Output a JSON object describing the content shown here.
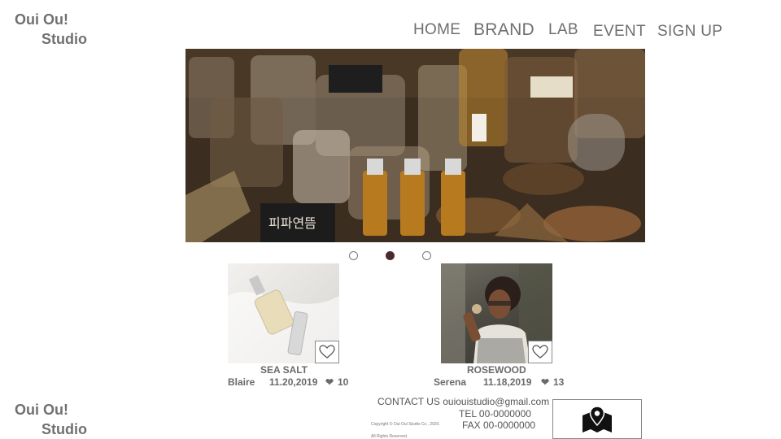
{
  "brand": {
    "line1": "Oui Ou!",
    "line2": "Studio"
  },
  "nav": [
    {
      "label": "HOME"
    },
    {
      "label": "BRAND"
    },
    {
      "label": "LAB"
    },
    {
      "label": "EVENT"
    },
    {
      "label": "SIGN UP"
    }
  ],
  "hero": {
    "image_icon": "perfume-bottles-photo",
    "label_text": "피파연뜸"
  },
  "carousel": {
    "count": 3,
    "active_index": 1
  },
  "cards": [
    {
      "title": "SEA SALT",
      "author": "Blaire",
      "date": "11.20,2019",
      "likes": "10",
      "image_icon": "perfume-bottle-photo"
    },
    {
      "title": "ROSEWOOD",
      "author": "Serena",
      "date": "11.18,2019",
      "likes": "13",
      "image_icon": "woman-smelling-flower-photo"
    }
  ],
  "footer": {
    "contact": "CONTACT US ouiouistudio@gmail.com",
    "tel": "TEL  00-0000000",
    "fax": "FAX  00-0000000",
    "copyright": "Copyright © Oui Oui Studio Co., 2020.",
    "rights": "All Rights Reserved.",
    "map_icon": "map-pin-icon"
  },
  "colors": {
    "text": "#6b6b6b",
    "dot_active": "#4a2a2a",
    "border": "#888888"
  }
}
